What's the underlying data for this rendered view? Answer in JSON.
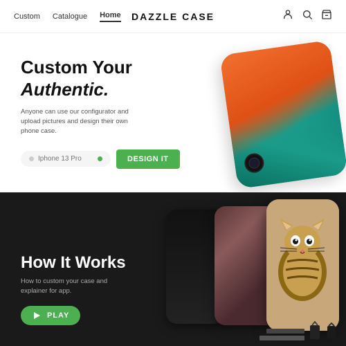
{
  "brand": "DAZZLE CASE",
  "nav": {
    "links": [
      {
        "label": "Custom",
        "active": false
      },
      {
        "label": "Catalogue",
        "active": false
      },
      {
        "label": "Home",
        "active": true
      }
    ],
    "icons": {
      "user": "👤",
      "search": "🔍",
      "cart": "✉"
    }
  },
  "hero": {
    "title_line1": "Custom Your",
    "title_line2": "Authentic.",
    "description": "Anyone can use our configurator and upload pictures and design their own phone case.",
    "input_placeholder": "Iphone 13 Pro",
    "design_button": "DESIGN IT"
  },
  "how_it_works": {
    "title": "How It Works",
    "description": "How to custom your case and explainer for app.",
    "play_button": "PLAY"
  }
}
